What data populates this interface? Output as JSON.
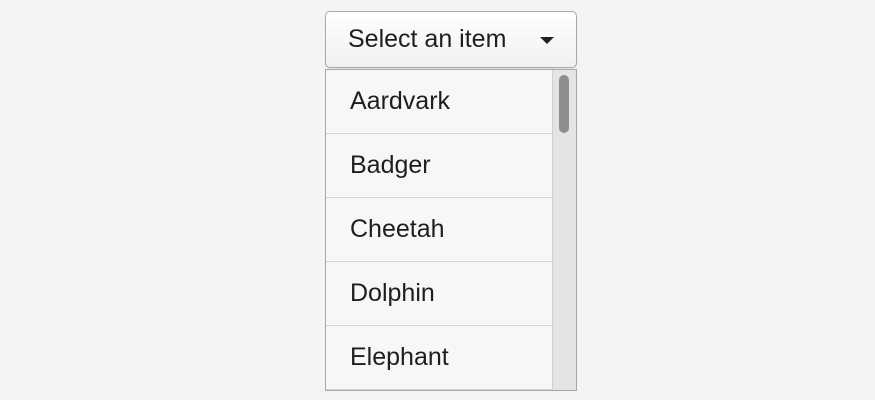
{
  "dropdown": {
    "label": "Select an item",
    "caret_icon": "caret-down-icon",
    "items": [
      {
        "label": "Aardvark"
      },
      {
        "label": "Badger"
      },
      {
        "label": "Cheetah"
      },
      {
        "label": "Dolphin"
      },
      {
        "label": "Elephant"
      }
    ],
    "scroll_position": 0
  },
  "colors": {
    "background": "#f4f4f4",
    "menu_background": "#f7f7f7",
    "border": "#a8a8a8",
    "scrollbar_track": "#e4e4e4",
    "scrollbar_thumb": "#8e8e8e"
  }
}
